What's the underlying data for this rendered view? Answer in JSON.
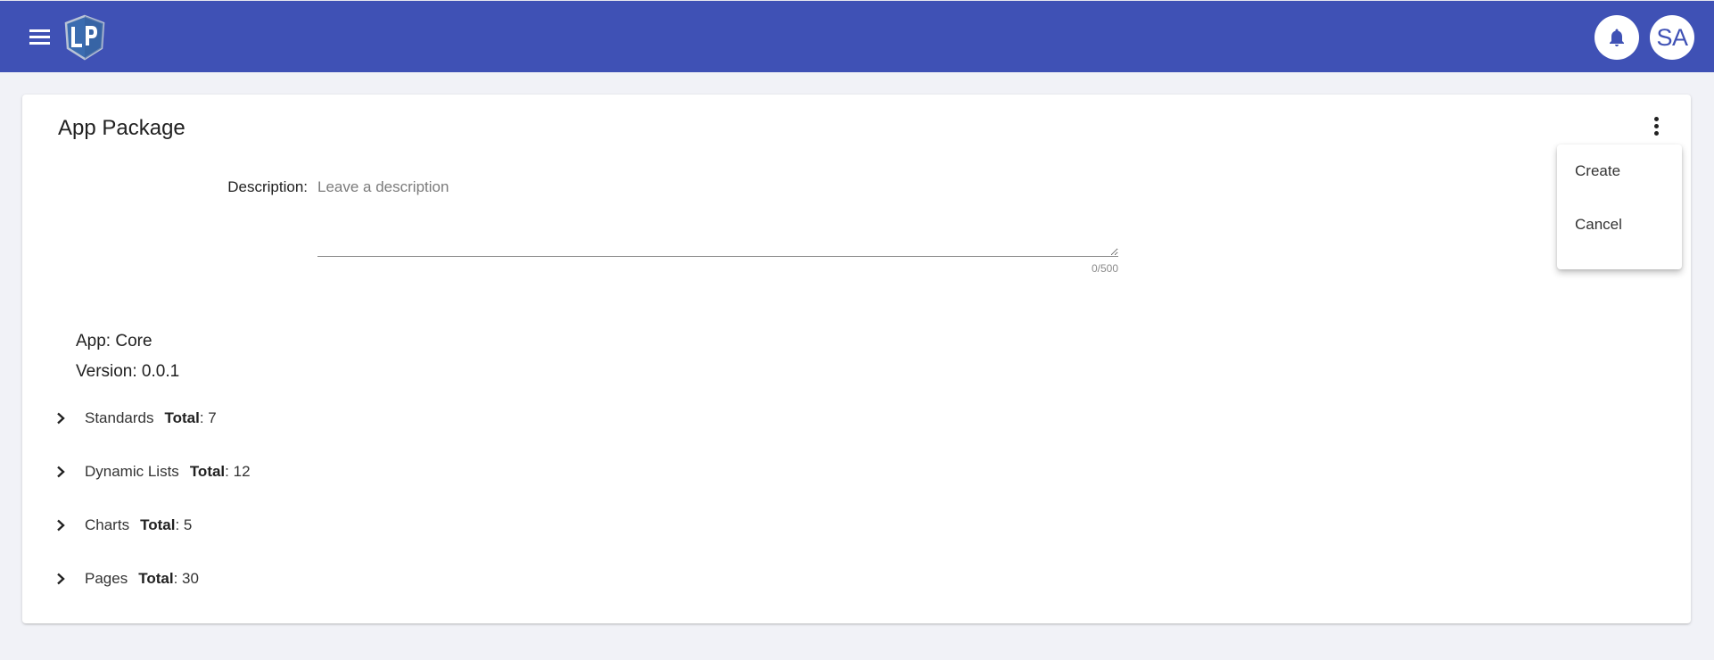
{
  "topbar": {
    "background_color": "#3f51b5",
    "menu_icon": "hamburger-menu-icon",
    "logo_text": "LP",
    "notification_icon": "bell-icon",
    "user_initials": "SA"
  },
  "card": {
    "title": "App Package",
    "more_icon": "more-vertical-icon",
    "description": {
      "label": "Description:",
      "value": "",
      "placeholder": "Leave a description",
      "counter": "0/500"
    },
    "app_label": "App: Core",
    "version_label": "Version: 0.0.1",
    "sections": [
      {
        "name": "Standards",
        "total_key": "Total",
        "total_value": ": 7"
      },
      {
        "name": "Dynamic Lists",
        "total_key": "Total",
        "total_value": ": 12"
      },
      {
        "name": "Charts",
        "total_key": "Total",
        "total_value": ": 5"
      },
      {
        "name": "Pages",
        "total_key": "Total",
        "total_value": ": 30"
      }
    ]
  },
  "menu": {
    "items": [
      {
        "label": "Create"
      },
      {
        "label": "Cancel"
      }
    ]
  }
}
